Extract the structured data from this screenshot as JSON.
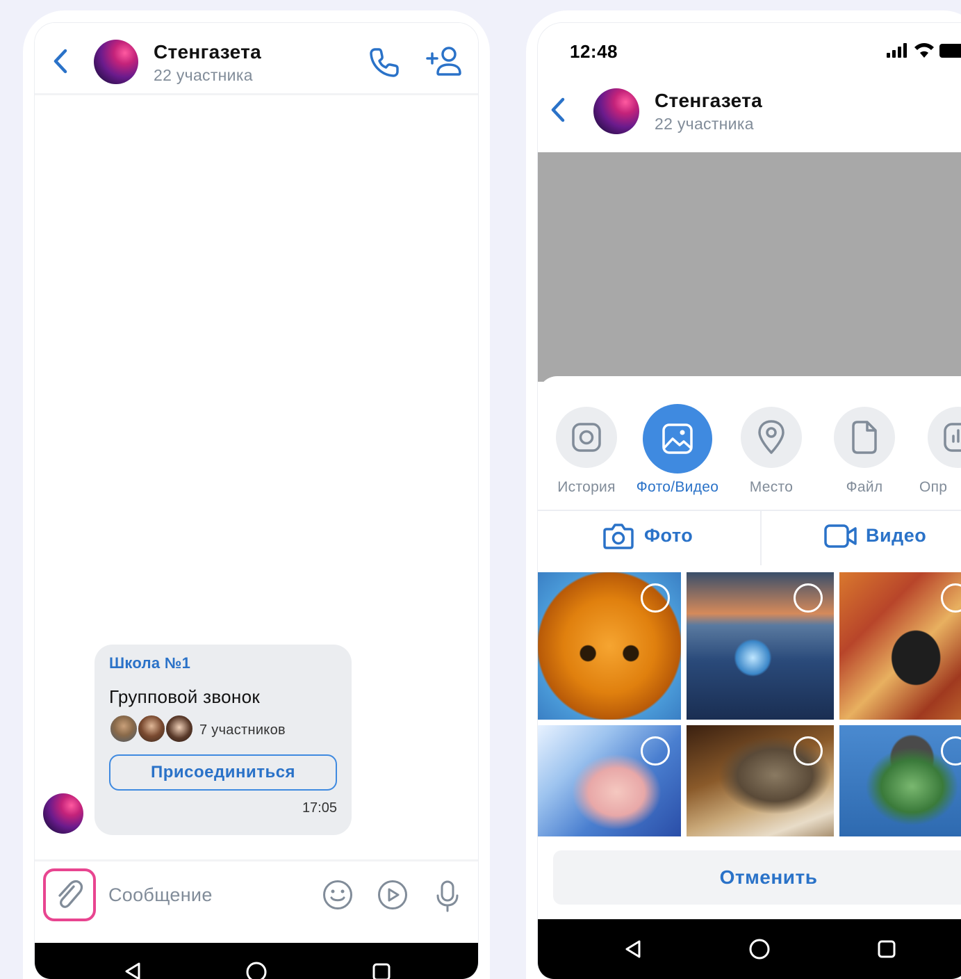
{
  "left_screen": {
    "header": {
      "title": "Стенгазета",
      "subtitle": "22 участника",
      "back_icon": "chevron-left-icon",
      "call_icon": "phone-icon",
      "add_member_icon": "add-user-icon"
    },
    "call_card": {
      "organization": "Школа №1",
      "title": "Групповой звонок",
      "participants": "7 участников",
      "join_label": "Присоединиться",
      "time": "17:05"
    },
    "composer": {
      "placeholder": "Сообщение",
      "attach_icon": "paperclip-icon",
      "emoji_icon": "smile-icon",
      "sticker_icon": "play-circle-icon",
      "mic_icon": "microphone-icon"
    }
  },
  "right_screen": {
    "status": {
      "time": "12:48"
    },
    "header": {
      "title": "Стенгазета",
      "subtitle": "22 участника"
    },
    "tools": [
      {
        "label": "История",
        "icon": "camera-square-icon",
        "active": false
      },
      {
        "label": "Фото/Видео",
        "icon": "image-icon",
        "active": true
      },
      {
        "label": "Место",
        "icon": "location-pin-icon",
        "active": false
      },
      {
        "label": "Файл",
        "icon": "document-icon",
        "active": false
      },
      {
        "label": "Опр",
        "icon": "poll-icon",
        "active": false
      }
    ],
    "tabs": {
      "photo": "Фото",
      "video": "Видео"
    },
    "cancel_label": "Отменить"
  },
  "colors": {
    "accent": "#2a72c8",
    "accent_bg": "#3f8ae0",
    "highlight": "#e84590",
    "muted": "#818c99",
    "bubble": "#ebedf0"
  }
}
